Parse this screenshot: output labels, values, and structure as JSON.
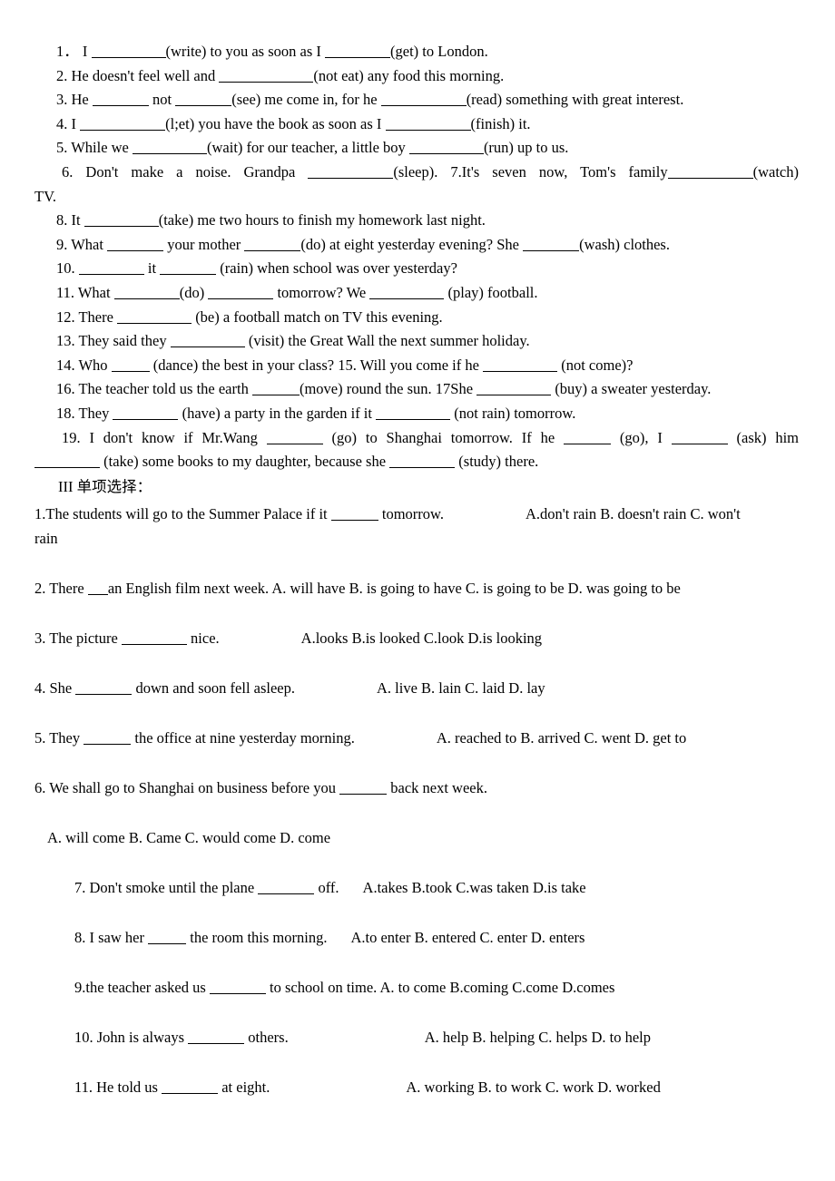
{
  "document": {
    "page_background": "#ffffff",
    "text_color": "#000000"
  },
  "fill_in_section": {
    "items": [
      {
        "number": "1．",
        "parts": [
          "  I ",
          "(write) to you as soon as I ",
          "(get) to London."
        ],
        "full_text": "1．  I ________(write) to you as soon as I _______(get) to London."
      },
      {
        "number": "2.",
        "parts": [
          " He doesn't feel well and ",
          "(not eat) any food this morning."
        ],
        "full_text": "2. He doesn't feel well and ___________(not eat) any food this morning."
      },
      {
        "number": "3.",
        "parts": [
          " He ",
          " not ",
          "(see) me come in, for he ",
          "(read) something with great interest."
        ],
        "full_text": "3. He ______ not ______(see) me come in, for he __________(read) something with great interest."
      },
      {
        "number": "4.",
        "parts": [
          " I ",
          "(l;et) you have the book as soon as I ",
          "(finish) it."
        ],
        "full_text": "4. I _________(l;et) you have the book as soon as I _________(finish) it."
      },
      {
        "number": "5.",
        "parts": [
          " While we ",
          "(wait) for our teacher, a little boy ",
          "(run) up to us."
        ],
        "full_text": "5. While we ________(wait) for our teacher, a little boy ________(run) up to us."
      },
      {
        "number": "6.",
        "parts": [
          " Don't make a noise. Grandpa ",
          "(sleep).   7.It's seven now, Tom's family",
          "(watch)"
        ],
        "full_text": "6. Don't make a noise. Grandpa __________(sleep).   7.It's seven now, Tom's family__________(watch) TV.",
        "wrapped_tail": "TV."
      },
      {
        "number": "8.",
        "parts": [
          " It ",
          "(take) me two hours to finish my homework last night."
        ],
        "full_text": "8. It ________(take) me two hours to finish my homework last night."
      },
      {
        "number": "9.",
        "parts": [
          " What ",
          " your mother ",
          "(do) at eight yesterday evening? She ",
          "(wash) clothes."
        ],
        "full_text": "9. What ______ your mother ______(do) at eight yesterday evening? She ______(wash) clothes."
      },
      {
        "number": "10.",
        "parts": [
          " ",
          " it ",
          " (rain) when school was over yesterday?"
        ],
        "full_text": "10. _______ it ______(rain) when school was over yesterday?"
      },
      {
        "number": "11.",
        "parts": [
          " What ",
          "(do) ",
          " tomorrow? We ",
          " (play) football."
        ],
        "full_text": "11. What _______(do) _______ tomorrow? We ________ (play) football."
      },
      {
        "number": "12.",
        "parts": [
          " There ",
          " (be) a football match on TV this evening."
        ],
        "full_text": "12. There ________ (be) a football match on TV this evening."
      },
      {
        "number": "13.",
        "parts": [
          " They said they ",
          " (visit) the Great Wall the next summer holiday."
        ],
        "full_text": "13. They said they ________ (visit) the Great Wall the next summer holiday."
      },
      {
        "number": "14.",
        "parts": [
          " Who ",
          " (dance) the best in your class?    15. Will you come if he ",
          " (not come)?"
        ],
        "full_text": "14. Who ____ (dance) the best in your class?    15. Will you come if he ________ (not come)?"
      },
      {
        "number": "16.",
        "parts": [
          " The teacher told us the earth ",
          "(move) round the sun.   17She ",
          " (buy) a sweater yesterday."
        ],
        "full_text": "16. The teacher told us the earth _____(move) round the sun.   17She ________ (buy) a sweater yesterday."
      },
      {
        "number": "18.",
        "parts": [
          " They ",
          " (have) a party in the garden if it ",
          " (not rain) tomorrow."
        ],
        "full_text": "18. They _______ (have) a party in the garden if it ________ (not rain) tomorrow."
      },
      {
        "number": "19.",
        "parts": [
          " I don't know if Mr.Wang ",
          " (go) to Shanghai tomorrow. If he ",
          " (go), I ",
          " (ask) him"
        ],
        "full_text": "19. I don't know if Mr.Wang ______ (go) to Shanghai tomorrow. If he _____ (go), I ______ (ask) him ________ (take) some books to my daughter, because she _______ (study) there.",
        "wrapped_tail": " (take) some books to my daughter, because she _______ (study) there."
      }
    ],
    "line_6": {
      "a": " Don't make a noise. Grandpa ",
      "b": "(sleep).",
      "c": "7.It's seven now, Tom's family",
      "d": "(watch)",
      "tail": "TV."
    },
    "line_19": {
      "a": " I don't know if Mr.Wang ",
      "b": " (go) to Shanghai tomorrow. If he ",
      "c": " (go), I ",
      "d": " (ask) him",
      "tail_a": " (take) some books to my daughter, because she ",
      "tail_b": " (study) there."
    }
  },
  "mc_section": {
    "heading": "III 单项选择：",
    "questions": [
      {
        "number": "1.",
        "stem_a": "The students will go to the Summer Palace if it ",
        "stem_b": " tomorrow.",
        "options": "A.don't rain B. doesn't rain C. won't",
        "options_wrap": "rain",
        "full_text": "1.The students will go to the Summer Palace if it _____ tomorrow.      A.don't rain B. doesn't rain C. won't rain"
      },
      {
        "number": "2.",
        "stem_a": " There ",
        "stem_b": "an English film next week. A. will have B. is going to have C. is going to be D. was going to be",
        "options": "",
        "full_text": "2. There __an English film next week. A. will have B. is going to have C. is going to be D. was going to be"
      },
      {
        "number": "3.",
        "stem_a": " The picture ",
        "stem_b": " nice.",
        "options": "A.looks   B.is looked   C.look   D.is looking",
        "full_text": "3. The picture _______ nice.        A.looks   B.is looked   C.look   D.is looking"
      },
      {
        "number": "4.",
        "stem_a": " She ",
        "stem_b": " down and soon fell asleep.",
        "options": "A. live B. lain C. laid D. lay",
        "full_text": "4. She ______ down and soon fell asleep.        A. live B. lain C. laid D. lay"
      },
      {
        "number": "5.",
        "stem_a": " They ",
        "stem_b": " the office at nine yesterday morning.",
        "options": "A. reached to B. arrived C. went D. get to",
        "full_text": "5. They _____ the office at nine yesterday morning.       A. reached to B. arrived C. went D. get to"
      },
      {
        "number": "6.",
        "stem_a": " We shall go to Shanghai on business before you ",
        "stem_b": " back next week.",
        "options": "A. will come   B. Came   C. would come   D. come",
        "full_text": "6. We shall go to Shanghai on business before you _____ back next week.    A. will come   B. Came   C. would come   D. come"
      },
      {
        "number": "7.",
        "stem_a": " Don't smoke until the plane ",
        "stem_b": " off.",
        "options": "A.takes B.took C.was taken D.is take",
        "full_text": "7. Don't smoke until the plane ______ off.   A.takes B.took C.was taken D.is take"
      },
      {
        "number": "8.",
        "stem_a": " I saw her ",
        "stem_b": " the room this morning.",
        "options": "A.to enter B. entered C. enter D. enters",
        "full_text": "8. I saw her ____ the room this morning.   A.to enter B. entered C. enter D. enters"
      },
      {
        "number": "9.",
        "stem_a": "the teacher asked us ",
        "stem_b": " to school on time. A. to come B.coming C.come D.comes",
        "options": "",
        "full_text": "9.the teacher asked us ______ to school on time. A. to come B.coming C.come D.comes"
      },
      {
        "number": "10.",
        "stem_a": " John is always ",
        "stem_b": " others.",
        "options": "A. help B. helping C. helps D. to help",
        "full_text": "10. John is always ______ others.              A. help B. helping C. helps D. to help"
      },
      {
        "number": "11.",
        "stem_a": " He told us ",
        "stem_b": " at eight.",
        "options": "A. working B. to work C. work D. worked",
        "full_text": "11. He told us ______ at eight.              A. working B. to work C. work D. worked"
      }
    ]
  }
}
